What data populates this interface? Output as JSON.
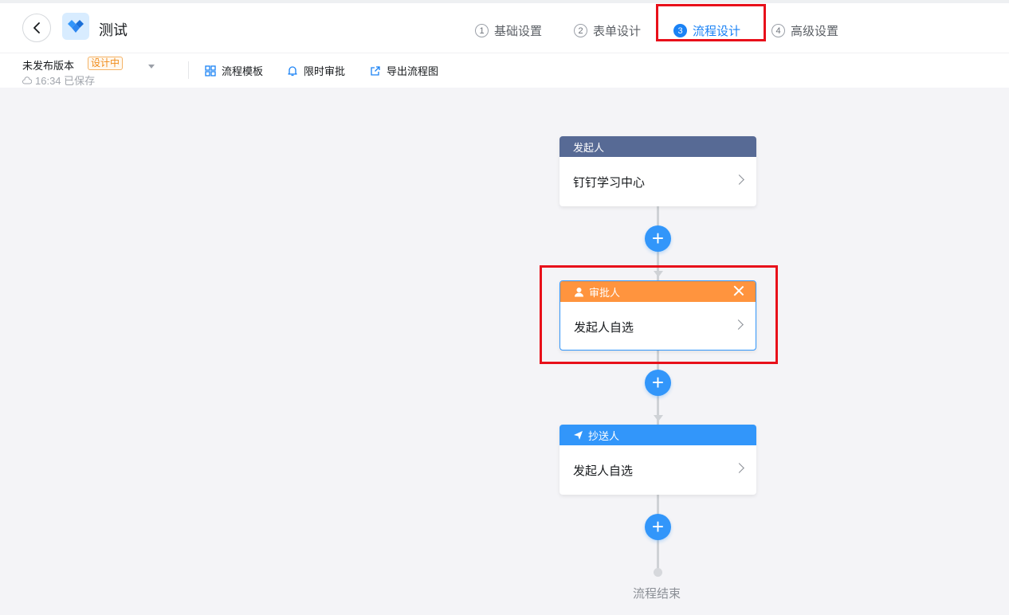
{
  "header": {
    "title": "测试",
    "steps": [
      {
        "num": "1",
        "label": "基础设置"
      },
      {
        "num": "2",
        "label": "表单设计"
      },
      {
        "num": "3",
        "label": "流程设计"
      },
      {
        "num": "4",
        "label": "高级设置"
      }
    ],
    "active_step": 3
  },
  "toolbar": {
    "version_label": "未发布版本",
    "version_badge": "设计中",
    "saved_text": "16:34 已保存",
    "tools": {
      "template": "流程模板",
      "timer": "限时审批",
      "export": "导出流程图"
    }
  },
  "flow": {
    "start": {
      "head": "发起人",
      "body": "钉钉学习中心"
    },
    "approver": {
      "head": "审批人",
      "body": "发起人自选"
    },
    "cc": {
      "head": "抄送人",
      "body": "发起人自选"
    },
    "end_label": "流程结束"
  },
  "colors": {
    "primary": "#3296fa",
    "start_head": "#576a95",
    "approver_head": "#ff943e",
    "cc_head": "#3296fa",
    "highlight": "#e8101a"
  }
}
